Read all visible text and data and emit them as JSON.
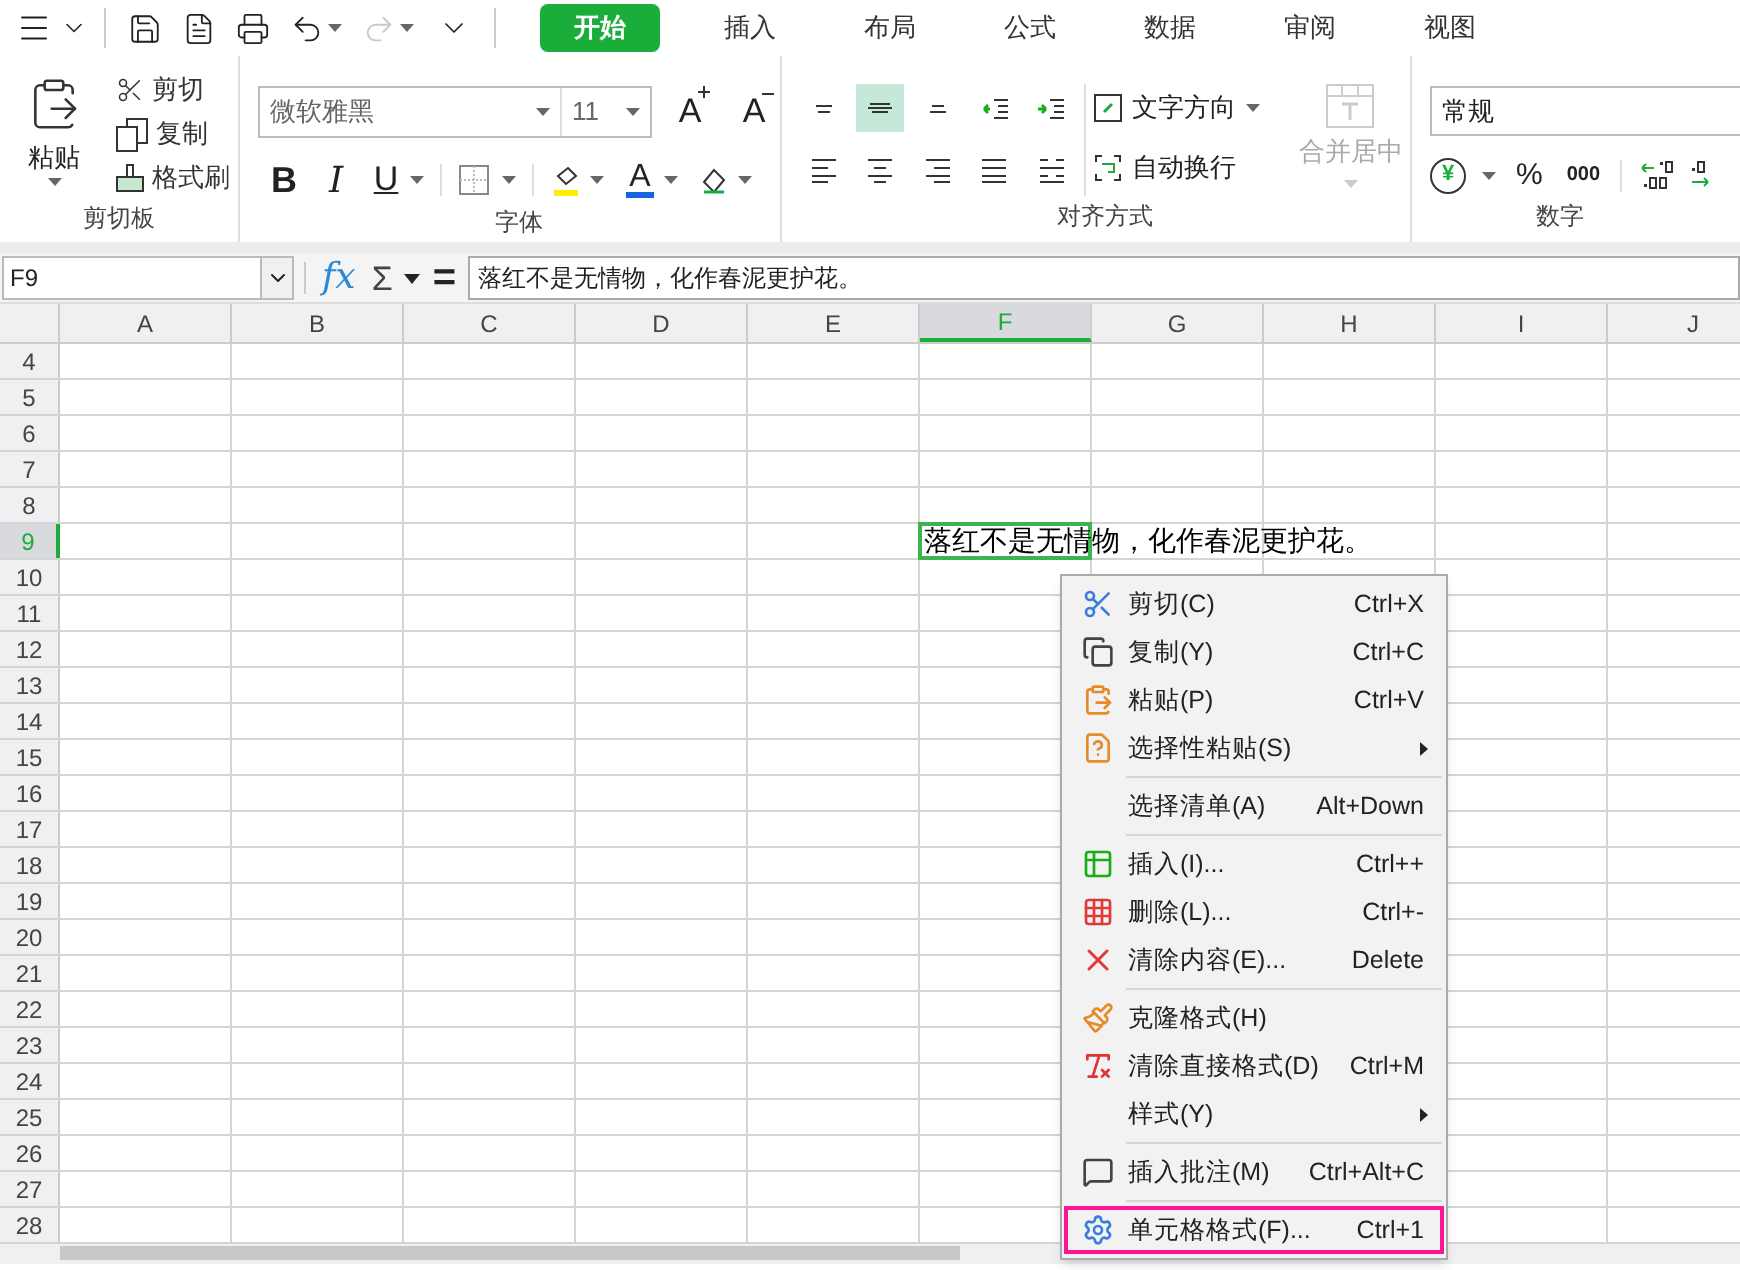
{
  "quick_access": {
    "redo": {
      "disabled": true
    }
  },
  "tabs": [
    {
      "label": "开始",
      "selected": true
    },
    {
      "label": "插入",
      "selected": false
    },
    {
      "label": "布局",
      "selected": false
    },
    {
      "label": "公式",
      "selected": false
    },
    {
      "label": "数据",
      "selected": false
    },
    {
      "label": "审阅",
      "selected": false
    },
    {
      "label": "视图",
      "selected": false
    }
  ],
  "ribbon": {
    "clipboard": {
      "paste": "粘贴",
      "cut": "剪切",
      "copy": "复制",
      "format_painter": "格式刷",
      "group_label": "剪切板"
    },
    "font": {
      "font_name": "微软雅黑",
      "font_size": "11",
      "grow": "A",
      "shrink": "A",
      "bold": "B",
      "italic": "I",
      "underline": "U",
      "font_color": "A",
      "group_label": "字体"
    },
    "alignment": {
      "buttons": [
        {
          "kind": "top",
          "selected": false
        },
        {
          "kind": "middle",
          "selected": true
        },
        {
          "kind": "bottom",
          "selected": false
        },
        {
          "kind": "indent-decrease",
          "selected": false
        },
        {
          "kind": "indent-increase",
          "selected": false
        },
        {
          "kind": "left",
          "selected": false
        },
        {
          "kind": "center",
          "selected": false
        },
        {
          "kind": "right",
          "selected": false
        },
        {
          "kind": "justify",
          "selected": false
        },
        {
          "kind": "distributed",
          "selected": false
        }
      ],
      "text_direction": "文字方向",
      "wrap_text": "自动换行",
      "merge_center": {
        "label": "合并居中",
        "disabled": true
      },
      "group_label": "对齐方式"
    },
    "number": {
      "format": "常规",
      "currency": "¥",
      "percent": "%",
      "thousands": "000",
      "group_label": "数字"
    }
  },
  "formula_bar": {
    "name_box": "F9",
    "function_symbol": "fx",
    "sum_symbol": "Σ",
    "equals_symbol": "=",
    "content": "落红不是无情物，化作春泥更护花。"
  },
  "sheet": {
    "columns": [
      {
        "label": "A",
        "selected": false
      },
      {
        "label": "B",
        "selected": false
      },
      {
        "label": "C",
        "selected": false
      },
      {
        "label": "D",
        "selected": false
      },
      {
        "label": "E",
        "selected": false
      },
      {
        "label": "F",
        "selected": true
      },
      {
        "label": "G",
        "selected": false
      },
      {
        "label": "H",
        "selected": false
      },
      {
        "label": "I",
        "selected": false
      },
      {
        "label": "J",
        "selected": false
      }
    ],
    "rows": [
      {
        "label": "4",
        "selected": false
      },
      {
        "label": "5",
        "selected": false
      },
      {
        "label": "6",
        "selected": false
      },
      {
        "label": "7",
        "selected": false
      },
      {
        "label": "8",
        "selected": false
      },
      {
        "label": "9",
        "selected": true
      },
      {
        "label": "10",
        "selected": false
      },
      {
        "label": "11",
        "selected": false
      },
      {
        "label": "12",
        "selected": false
      },
      {
        "label": "13",
        "selected": false
      },
      {
        "label": "14",
        "selected": false
      },
      {
        "label": "15",
        "selected": false
      },
      {
        "label": "16",
        "selected": false
      },
      {
        "label": "17",
        "selected": false
      },
      {
        "label": "18",
        "selected": false
      },
      {
        "label": "19",
        "selected": false
      },
      {
        "label": "20",
        "selected": false
      },
      {
        "label": "21",
        "selected": false
      },
      {
        "label": "22",
        "selected": false
      },
      {
        "label": "23",
        "selected": false
      },
      {
        "label": "24",
        "selected": false
      },
      {
        "label": "25",
        "selected": false
      },
      {
        "label": "26",
        "selected": false
      },
      {
        "label": "27",
        "selected": false
      },
      {
        "label": "28",
        "selected": false
      }
    ],
    "active_cell": {
      "text": "落红不是无情物，化作春泥更护花。"
    }
  },
  "context_menu": {
    "items": [
      {
        "kind": "item",
        "label": "剪切(C)",
        "shortcut": "Ctrl+X",
        "submenu": false,
        "outlined": false
      },
      {
        "kind": "item",
        "label": "复制(Y)",
        "shortcut": "Ctrl+C",
        "submenu": false,
        "outlined": false
      },
      {
        "kind": "item",
        "label": "粘贴(P)",
        "shortcut": "Ctrl+V",
        "submenu": false,
        "outlined": false
      },
      {
        "kind": "item",
        "label": "选择性粘贴(S)",
        "submenu": true,
        "outlined": false
      },
      {
        "kind": "separator"
      },
      {
        "kind": "item",
        "label": "选择清单(A)",
        "shortcut": "Alt+Down",
        "submenu": false,
        "outlined": false
      },
      {
        "kind": "separator"
      },
      {
        "kind": "item",
        "label": "插入(I)...",
        "shortcut": "Ctrl++",
        "submenu": false,
        "outlined": false
      },
      {
        "kind": "item",
        "label": "删除(L)...",
        "shortcut": "Ctrl+-",
        "submenu": false,
        "outlined": false
      },
      {
        "kind": "item",
        "label": "清除内容(E)...",
        "shortcut": "Delete",
        "submenu": false,
        "outlined": false
      },
      {
        "kind": "separator"
      },
      {
        "kind": "item",
        "label": "克隆格式(H)",
        "submenu": false,
        "outlined": false
      },
      {
        "kind": "item",
        "label": "清除直接格式(D)",
        "shortcut": "Ctrl+M",
        "submenu": false,
        "outlined": false
      },
      {
        "kind": "item",
        "label": "样式(Y)",
        "submenu": true,
        "outlined": false
      },
      {
        "kind": "separator"
      },
      {
        "kind": "item",
        "label": "插入批注(M)",
        "shortcut": "Ctrl+Alt+C",
        "submenu": false,
        "outlined": false
      },
      {
        "kind": "separator"
      },
      {
        "kind": "item",
        "label": "单元格格式(F)...",
        "shortcut": "Ctrl+1",
        "submenu": false,
        "outlined": true
      }
    ]
  }
}
